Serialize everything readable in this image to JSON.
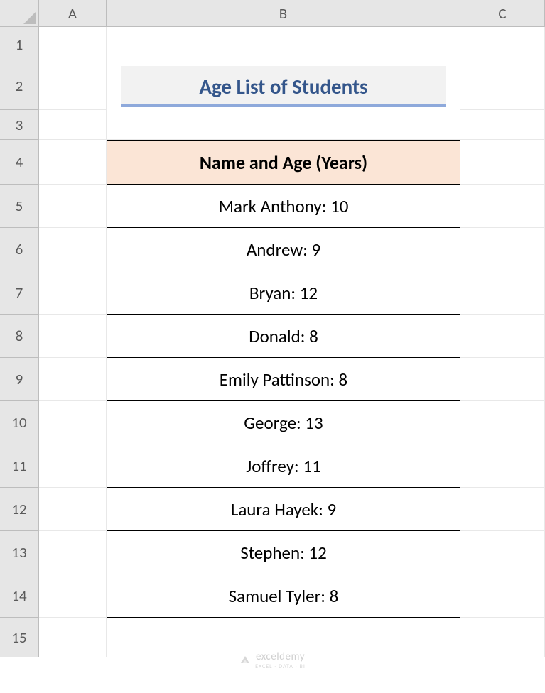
{
  "columns": [
    "A",
    "B",
    "C"
  ],
  "rows": [
    "1",
    "2",
    "3",
    "4",
    "5",
    "6",
    "7",
    "8",
    "9",
    "10",
    "11",
    "12",
    "13",
    "14",
    "15"
  ],
  "title": "Age List of Students",
  "table": {
    "header": "Name and Age (Years)",
    "rows": [
      "Mark Anthony: 10",
      "Andrew: 9",
      "Bryan: 12",
      "Donald: 8",
      "Emily Pattinson: 8",
      "George: 13",
      "Joffrey: 11",
      "Laura Hayek: 9",
      "Stephen: 12",
      "Samuel Tyler: 8"
    ]
  },
  "watermark": {
    "brand": "exceldemy",
    "tagline": "EXCEL · DATA · BI"
  },
  "chart_data": {
    "type": "table",
    "title": "Age List of Students",
    "columns": [
      "Name",
      "Age (Years)"
    ],
    "rows": [
      [
        "Mark Anthony",
        10
      ],
      [
        "Andrew",
        9
      ],
      [
        "Bryan",
        12
      ],
      [
        "Donald",
        8
      ],
      [
        "Emily Pattinson",
        8
      ],
      [
        "George",
        13
      ],
      [
        "Joffrey",
        11
      ],
      [
        "Laura Hayek",
        9
      ],
      [
        "Stephen",
        12
      ],
      [
        "Samuel Tyler",
        8
      ]
    ]
  }
}
